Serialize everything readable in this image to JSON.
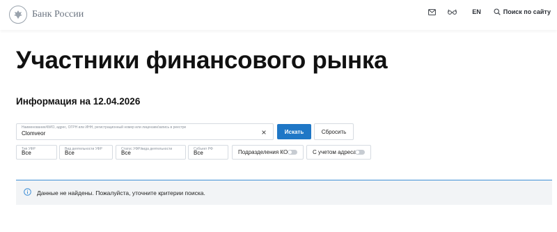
{
  "header": {
    "logo_text": "Банк России",
    "language": "EN",
    "search_label": "Поиск по сайту",
    "icons": [
      "emblem-icon",
      "mail-icon",
      "glasses-icon",
      "search-icon"
    ]
  },
  "page": {
    "title": "Участники финансового рынка",
    "info_date": "Информация на 12.04.2026"
  },
  "search": {
    "label": "Наименование/ФИО, адрес, ОГРН или ИНН, регистрационный номер или лицензии/запись в реестре",
    "value": "Clomveor",
    "search_button": "Искать",
    "reset_button": "Сбросить"
  },
  "filters": [
    {
      "label": "Тип УФР",
      "value": "Все"
    },
    {
      "label": "Вид деятельности УФР",
      "value": "Все"
    },
    {
      "label": "Статус УФР/вида деятельности",
      "value": "Все"
    },
    {
      "label": "Субъект РФ",
      "value": "Все"
    }
  ],
  "toggles": [
    {
      "label": "Подразделения КО",
      "on": false
    },
    {
      "label": "С учетом адреса",
      "on": false
    }
  ],
  "notice": {
    "message": "Данные не найдены. Пожалуйста, уточните критерии поиска.",
    "icon": "info-icon"
  },
  "colors": {
    "accent": "#1f77c6",
    "notice_border": "#3f8fd6",
    "notice_bg": "#f2f4f6"
  }
}
